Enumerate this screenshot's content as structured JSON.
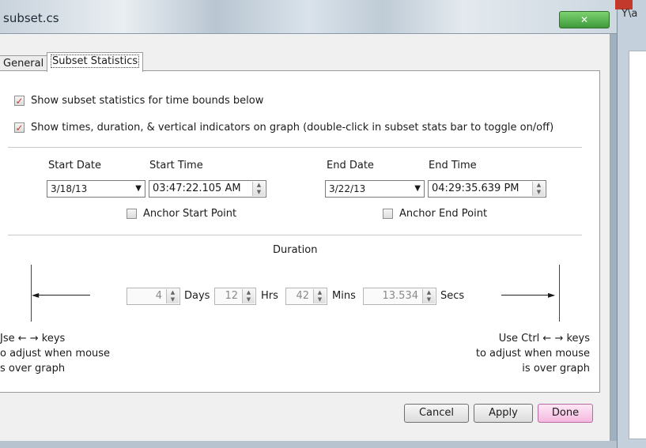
{
  "window": {
    "title": "subset.cs",
    "close_glyph": "✕",
    "side_title": "Y\\a"
  },
  "tabs": [
    {
      "label": "General"
    },
    {
      "label": "Subset Statistics"
    }
  ],
  "options": {
    "show_stats": {
      "label": "Show subset statistics for time bounds below",
      "checked": true
    },
    "show_indicators": {
      "label": "Show times, duration, & vertical indicators on graph (double-click in subset stats bar to toggle on/off)",
      "checked": true
    }
  },
  "start": {
    "date_label": "Start Date",
    "date_value": "3/18/13",
    "time_label": "Start Time",
    "time_value": "03:47:22.105 AM",
    "anchor_label": "Anchor Start Point",
    "anchor_checked": false
  },
  "end": {
    "date_label": "End Date",
    "date_value": "3/22/13",
    "time_label": "End Time",
    "time_value": "04:29:35.639 PM",
    "anchor_label": "Anchor End Point",
    "anchor_checked": false
  },
  "duration": {
    "label": "Duration",
    "days": "4",
    "days_label": "Days",
    "hrs": "12",
    "hrs_label": "Hrs",
    "mins": "42",
    "mins_label": "Mins",
    "secs": "13.534",
    "secs_label": "Secs"
  },
  "hints": {
    "left": [
      "Jse ← → keys",
      "o adjust when mouse",
      "s over graph"
    ],
    "right": [
      "Use Ctrl ← → keys",
      "to adjust when mouse",
      "is over graph"
    ]
  },
  "buttons": {
    "cancel": "Cancel",
    "apply": "Apply",
    "done": "Done"
  },
  "colors": {
    "check": "#c0392b",
    "done_bg": "#f4b9e0",
    "close_bg": "#3f9a3a"
  },
  "icons": {
    "dropdown": "▼",
    "spin": "▲▼"
  }
}
